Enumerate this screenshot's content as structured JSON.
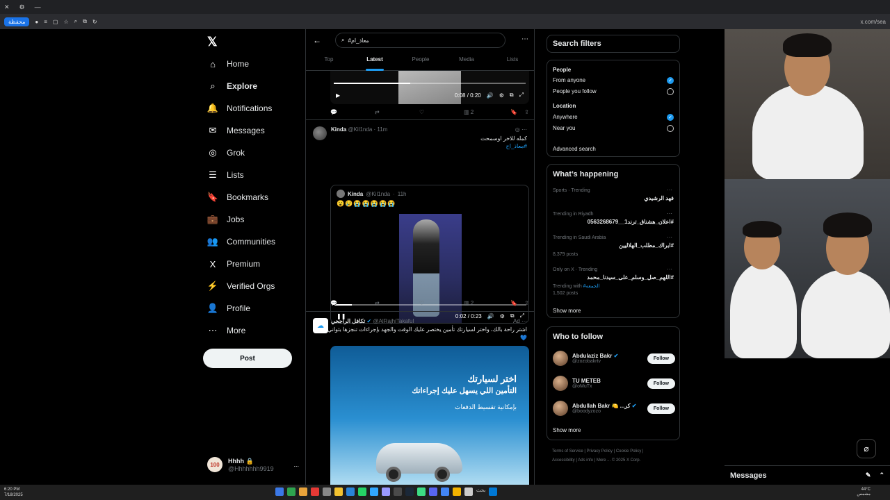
{
  "browser": {
    "tab_controls": [
      "✕",
      "⚙",
      "—"
    ],
    "badge": "محفظة",
    "url": "x.com/sea"
  },
  "nav": {
    "items": [
      {
        "label": "Home",
        "icon": "home-icon",
        "glyph": "⌂"
      },
      {
        "label": "Explore",
        "icon": "search-icon",
        "glyph": "⌕"
      },
      {
        "label": "Notifications",
        "icon": "bell-icon",
        "glyph": "🔔"
      },
      {
        "label": "Messages",
        "icon": "mail-icon",
        "glyph": "✉"
      },
      {
        "label": "Grok",
        "icon": "grok-icon",
        "glyph": "◎"
      },
      {
        "label": "Lists",
        "icon": "list-icon",
        "glyph": "☰"
      },
      {
        "label": "Bookmarks",
        "icon": "bookmark-icon",
        "glyph": "🔖"
      },
      {
        "label": "Jobs",
        "icon": "briefcase-icon",
        "glyph": "💼"
      },
      {
        "label": "Communities",
        "icon": "communities-icon",
        "glyph": "👥"
      },
      {
        "label": "Premium",
        "icon": "x-premium-icon",
        "glyph": "X"
      },
      {
        "label": "Verified Orgs",
        "icon": "lightning-icon",
        "glyph": "⚡"
      },
      {
        "label": "Profile",
        "icon": "profile-icon",
        "glyph": "👤"
      },
      {
        "label": "More",
        "icon": "more-circle-icon",
        "glyph": "⋯"
      }
    ],
    "post_label": "Post",
    "account": {
      "avatar_text": "100",
      "name": "Hhhh 🔒",
      "handle": "@Hhhhhhh9919",
      "menu": "..."
    }
  },
  "search": {
    "query": "#معاذ_ام",
    "tabs": [
      "Top",
      "Latest",
      "People",
      "Media",
      "Lists"
    ],
    "active_tab": "Latest"
  },
  "feed": {
    "video1": {
      "time": "0:08 / 0:20",
      "progress_fraction": 0.4
    },
    "video1_actions": {
      "views": "2"
    },
    "tweet2": {
      "name": "Kinda",
      "handle": "@Kil1nda",
      "time": "11m",
      "text": "كمله للاخر اوسمحت",
      "hashtag": "#معاذ_اح",
      "quote": {
        "name": "Kinda",
        "handle": "@Kil1nda",
        "time": "11h",
        "emoji": "😮😢😭😭😭😭😭"
      },
      "video_time": "0:02 / 0:23",
      "video_progress_fraction": 0.09,
      "views": "2"
    },
    "ad": {
      "name": "تكافل الراجحي",
      "handle": "@AlRajhiTakaful",
      "label": "Ad",
      "text": "اشتر راحة بالك، واختر لسيارتك تأمين يختصر عليك الوقت والجهد بإجراءات تنجزها بثواني",
      "headline1": "اختر لسيارتك",
      "headline2": "التأمين اللي يسهل عليك إجراءاتك",
      "headline3": "بإمكانية تقسيط الدفعات"
    }
  },
  "filters": {
    "title": "Search filters",
    "people_label": "People",
    "people_opts": [
      {
        "label": "From anyone",
        "on": true
      },
      {
        "label": "People you follow",
        "on": false
      }
    ],
    "location_label": "Location",
    "location_opts": [
      {
        "label": "Anywhere",
        "on": true
      },
      {
        "label": "Near you",
        "on": false
      }
    ],
    "advanced": "Advanced search"
  },
  "trending": {
    "title": "What’s happening",
    "items": [
      {
        "cat": "Sports · Trending",
        "name": "فهد الرشيدي",
        "posts": ""
      },
      {
        "cat": "Trending in Riyadh",
        "name": "#اعلان_هشناق_ترند1__0563268679",
        "posts": ""
      },
      {
        "cat": "Trending in Saudi Arabia",
        "name": "#ابراك_مطلب_الهلاليين",
        "posts": "8,379 posts"
      },
      {
        "cat": "Only on X · Trending",
        "name": "#اللهم_صل_وسلم_على_سيدنا_محمد",
        "posts": "1,502 posts",
        "with": "Trending with",
        "with_tag": "#الجمعه"
      }
    ],
    "show_more": "Show more"
  },
  "who_to_follow": {
    "title": "Who to follow",
    "people": [
      {
        "name": "Abdulaziz Bakr",
        "handle": "@zozobakrtv",
        "verified": true,
        "button": "Follow"
      },
      {
        "name": "TU METEB",
        "handle": "@oMuTx",
        "verified": false,
        "button": "Follow"
      },
      {
        "name": "Abdullah Bakr 🍋 ...كر",
        "handle": "@boodyzozo",
        "verified": true,
        "button": "Follow"
      }
    ],
    "show_more": "Show more"
  },
  "footer": {
    "links": [
      "Terms of Service",
      "Privacy Policy",
      "Cookie Policy",
      "Accessibility",
      "Ads info",
      "More ...",
      "© 2025 X Corp."
    ]
  },
  "messages_tray": {
    "title": "Messages"
  },
  "taskbar": {
    "time": "6:20 PM",
    "date": "7/18/2025",
    "search": "بحث",
    "temp": "44°C",
    "weather": "مشمس"
  },
  "colors": {
    "accent": "#1d9bf0",
    "bg": "#000000",
    "border": "#2f3336",
    "muted": "#71767b"
  }
}
